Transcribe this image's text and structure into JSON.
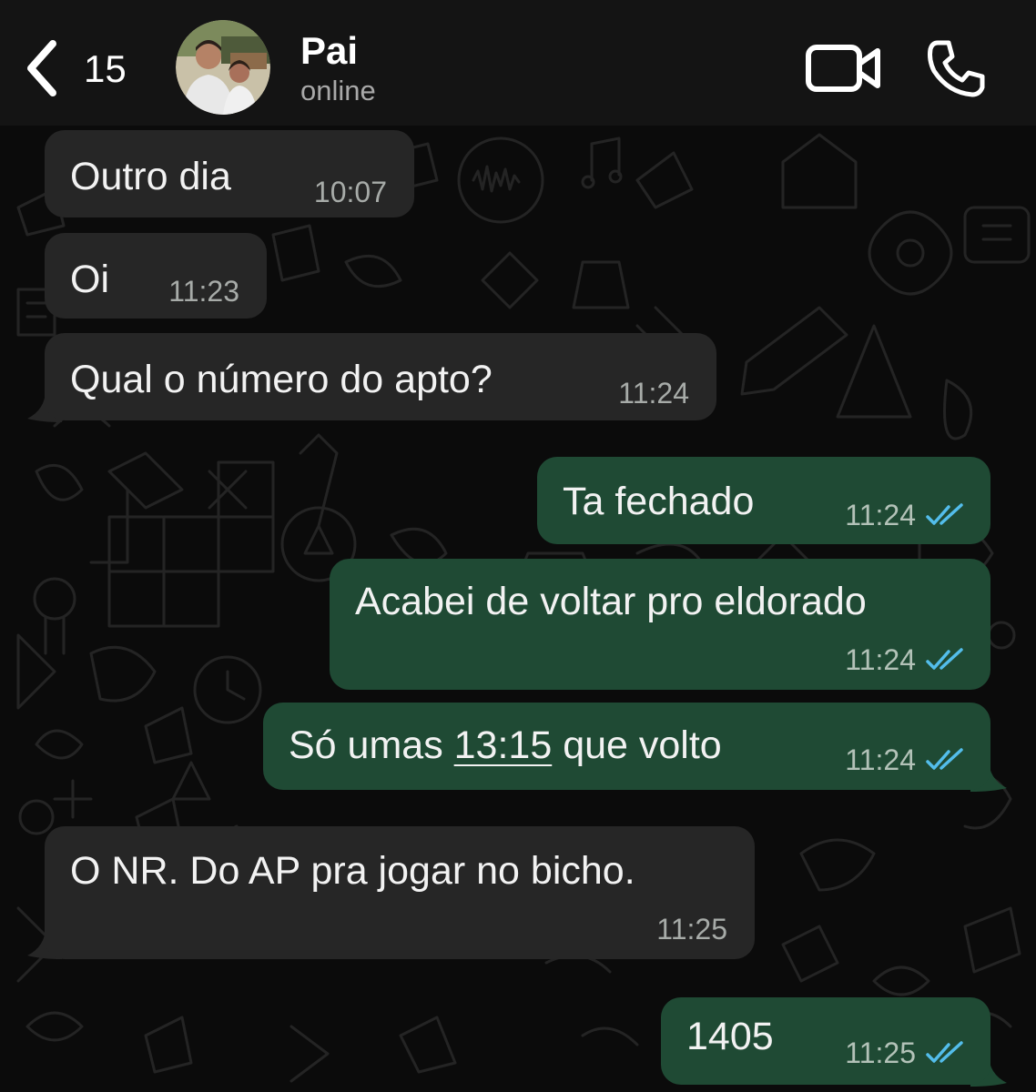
{
  "header": {
    "back_count": "15",
    "contact_name": "Pai",
    "contact_status": "online"
  },
  "messages": [
    {
      "direction": "in",
      "text": "Outro dia",
      "time": "10:07"
    },
    {
      "direction": "in",
      "text": "Oi",
      "time": "11:23"
    },
    {
      "direction": "in",
      "text": "Qual o número do apto?",
      "time": "11:24"
    },
    {
      "direction": "out",
      "text": "Ta fechado",
      "time": "11:24",
      "status": "read"
    },
    {
      "direction": "out",
      "text": "Acabei de voltar pro eldorado",
      "time": "11:24",
      "status": "read"
    },
    {
      "direction": "out",
      "text_before": "Só umas ",
      "text_link": "13:15",
      "text_after": " que volto",
      "time": "11:24",
      "status": "read"
    },
    {
      "direction": "in",
      "text": "O NR. Do AP pra jogar no bicho.",
      "time": "11:25"
    },
    {
      "direction": "out",
      "text": "1405",
      "time": "11:25",
      "status": "read"
    }
  ],
  "colors": {
    "incoming_bubble": "#262626",
    "outgoing_bubble": "#1f4a34",
    "read_ticks": "#53bdeb",
    "background": "#0b0b0b"
  },
  "icons": {
    "back": "chevron-left-icon",
    "video": "video-camera-icon",
    "call": "phone-icon"
  }
}
